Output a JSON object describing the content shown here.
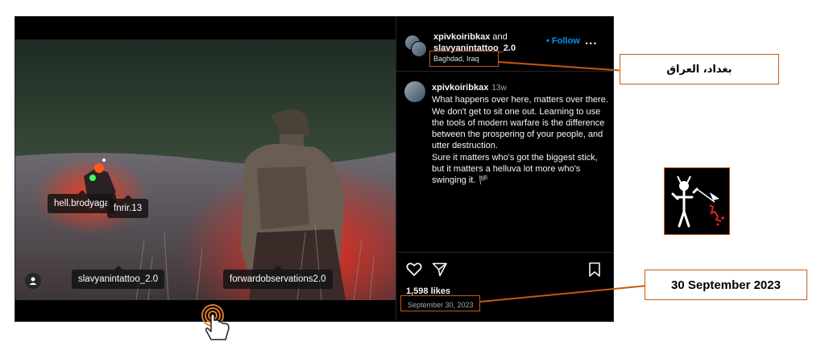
{
  "post": {
    "header": {
      "user1": "xpivkoiribkax",
      "and_text": " and ",
      "user2": "slavyanintattoo_2.0",
      "location": "Baghdad, Iraq",
      "follow_label": "Follow",
      "more_label": "..."
    },
    "photo_tags": [
      {
        "label": "hell.brodyaga"
      },
      {
        "label": "fnrir.13"
      },
      {
        "label": "slavyanintattoo_2.0"
      },
      {
        "label": "forwardobservations2.0"
      }
    ],
    "caption": {
      "username": "xpivkoiribkax",
      "time_ago": "13w",
      "lines": [
        "What happens over here, matters over there. We don't get to sit one out. Learning to use the tools of modern warfare is the difference between the prospering of your people, and utter destruction.",
        "Sure it matters who's got the biggest stick, but it matters a helluva lot more who's swinging it. 🏴"
      ]
    },
    "likes": "1,598 likes",
    "date": "September 30, 2023",
    "icons": [
      "heart-icon",
      "share-icon",
      "bookmark-icon",
      "more-icon",
      "user-tag-icon"
    ]
  },
  "annotations": {
    "location_callout": "بغداد، العراق",
    "date_callout": "30 September 2023",
    "highlight_color": "#c55a11"
  },
  "colors": {
    "follow": "#0095f6",
    "background": "#000000"
  }
}
